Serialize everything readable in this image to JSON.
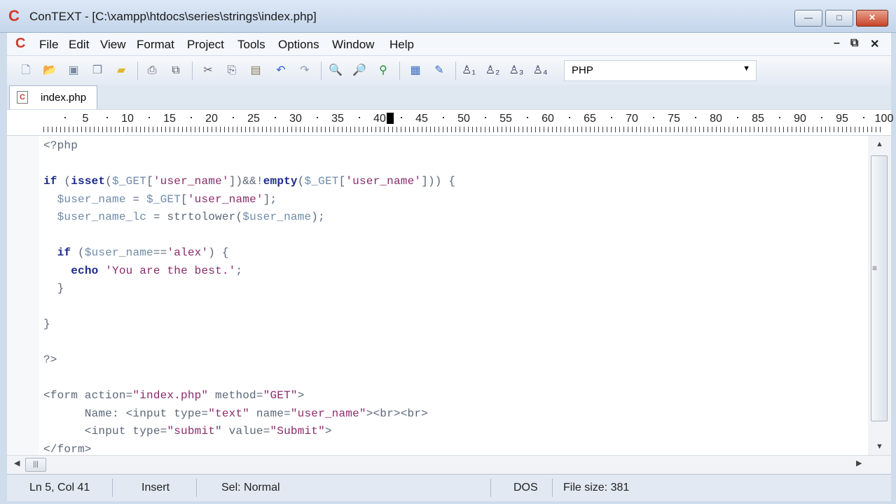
{
  "window": {
    "title": "ConTEXT - [C:\\xampp\\htdocs\\series\\strings\\index.php]",
    "controls": {
      "minimize": "—",
      "maximize": "□",
      "close": "✕"
    }
  },
  "menu": {
    "items": [
      "File",
      "Edit",
      "View",
      "Format",
      "Project",
      "Tools",
      "Options",
      "Window",
      "Help"
    ],
    "mdi_controls": {
      "minimize": "–",
      "restore": "⧉",
      "close": "✕"
    }
  },
  "toolbar": {
    "language": "PHP",
    "icons": [
      "new-file-icon",
      "open-icon",
      "save-icon",
      "save-all-icon",
      "open-folder-icon",
      "print-icon",
      "print-preview-icon",
      "cut-icon",
      "copy-icon",
      "paste-icon",
      "undo-icon",
      "redo-icon",
      "find-icon",
      "find-next-icon",
      "replace-icon",
      "export-icon",
      "tools-icon",
      "user-exec-1-icon",
      "user-exec-2-icon",
      "user-exec-3-icon",
      "user-exec-4-icon"
    ]
  },
  "tabs": [
    {
      "label": "index.php"
    }
  ],
  "ruler": {
    "labels": [
      "5",
      "10",
      "15",
      "20",
      "25",
      "30",
      "35",
      "40",
      "45",
      "50",
      "55",
      "60",
      "65",
      "70",
      "75",
      "80",
      "85",
      "90",
      "95",
      "100"
    ],
    "cursor_column": 41
  },
  "code": [
    "<?php",
    "",
    "if (isset($_GET['user_name'])&&!empty($_GET['user_name'])) {",
    "  $user_name = $_GET['user_name'];",
    "  $user_name_lc = strtolower($user_name);",
    "",
    "  if ($user_name=='alex') {",
    "    echo 'You are the best.';",
    "  }",
    "",
    "}",
    "",
    "?>",
    "",
    "<form action=\"index.php\" method=\"GET\">",
    "      Name: <input type=\"text\" name=\"user_name\"><br><br>",
    "      <input type=\"submit\" value=\"Submit\">",
    "</form>"
  ],
  "status": {
    "position": "Ln 5, Col 41",
    "mode": "Insert",
    "selection": "Sel: Normal",
    "line_endings": "DOS",
    "file_size": "File size: 381"
  },
  "colors": {
    "logo": "#d13a2c",
    "keyword": "#1d2b8a",
    "string": "#8a2b6a",
    "variable": "#6f8aa8"
  }
}
